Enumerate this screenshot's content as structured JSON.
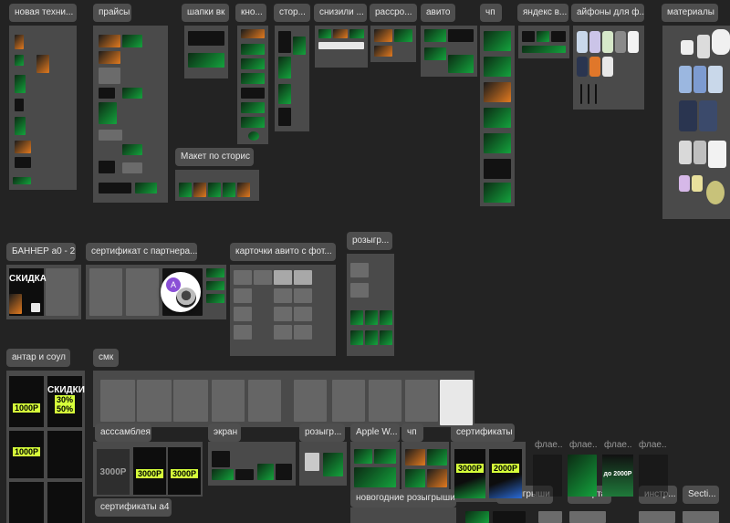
{
  "labels": {
    "new_tech": "новая техни...",
    "prices": "прайсы",
    "vk_headers": "шапки вк",
    "kno": "кно...",
    "stor": "стор...",
    "price_down": "снизили ...",
    "installment": "рассро...",
    "avito": "авито",
    "chp": "чп",
    "yandex": "яндекс в...",
    "iphones_for": "айфоны для ф...",
    "materials": "материалы",
    "stories_layout": "Макет по сторис",
    "banner": "БАННЕР а0 - 2",
    "cert_partner": "сертификат с партнера...",
    "avito_cards": "карточки авито с фот...",
    "giveaway_top": "розыгр...",
    "antar": "антар и соул",
    "smk": "смк",
    "assembly": "асссамблея",
    "screen": "экран",
    "giveaway_mid": "розыгр...",
    "apple_w": "Apple W...",
    "chp2": "чп",
    "certs": "сертификаты",
    "flyer1": "флае...",
    "flyer2": "флае...",
    "flyer3": "флае...",
    "flyer4": "флае...",
    "certs_a4": "сертификаты а4",
    "ny_giveaways": "новогодние розыгрыши",
    "giveaways": "розыгрыши",
    "march8": "8 марта",
    "instr": "инстр...",
    "secti": "Secti..."
  },
  "avatar": {
    "initial": "A"
  },
  "posters": {
    "banner_sale": "СКИДКА",
    "antar_1000a": "1000Р",
    "antar_sale": "СКИДКИ",
    "antar_30": "30%",
    "antar_50": "50%",
    "antar_1000b": "1000Р",
    "cert_3000a": "3000Р",
    "cert_3000b": "3000Р",
    "cert_3000c": "3000Р",
    "cert_2000": "2000Р",
    "flyer_2000": "до 2000Р"
  },
  "colors": {
    "canvas": "#232323",
    "section": "#4a4a4a",
    "label_bg": "#4e4e4e",
    "accent_green": "#14a33d",
    "accent_orange": "#e27a1f",
    "avatar_purple": "#8a4fd6"
  }
}
